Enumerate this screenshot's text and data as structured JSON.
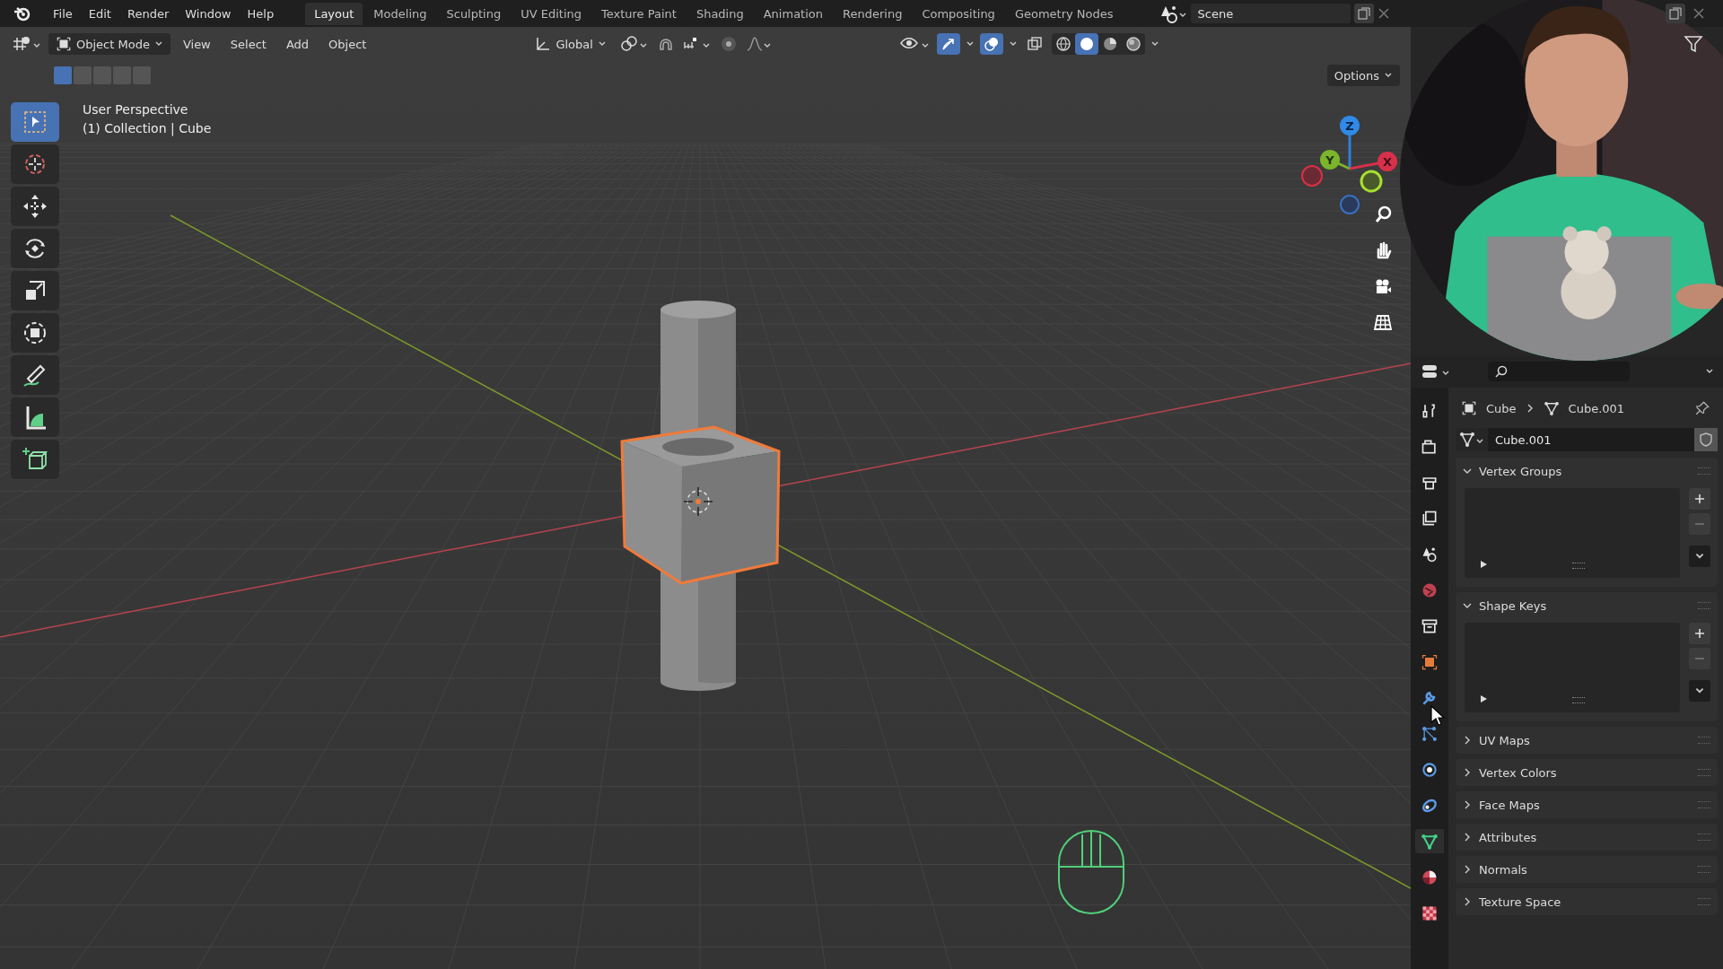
{
  "menu": [
    "File",
    "Edit",
    "Render",
    "Window",
    "Help"
  ],
  "workspaces": [
    {
      "label": "Layout",
      "selected": true
    },
    {
      "label": "Modeling",
      "selected": false
    },
    {
      "label": "Sculpting",
      "selected": false
    },
    {
      "label": "UV Editing",
      "selected": false
    },
    {
      "label": "Texture Paint",
      "selected": false
    },
    {
      "label": "Shading",
      "selected": false
    },
    {
      "label": "Animation",
      "selected": false
    },
    {
      "label": "Rendering",
      "selected": false
    },
    {
      "label": "Compositing",
      "selected": false
    },
    {
      "label": "Geometry Nodes",
      "selected": false
    }
  ],
  "scene": {
    "name": "Scene"
  },
  "viewport": {
    "mode": "Object Mode",
    "menus": [
      "View",
      "Select",
      "Add",
      "Object"
    ],
    "orientation": "Global",
    "options": "Options",
    "select_modes": [
      {
        "selected": true
      },
      {
        "selected": false
      },
      {
        "selected": false
      },
      {
        "selected": false
      },
      {
        "selected": false
      }
    ],
    "toggles": [
      {
        "kind": "gizmo",
        "on": true
      },
      {
        "kind": "overlays",
        "on": true
      },
      {
        "kind": "xray",
        "on": false
      }
    ],
    "shading": [
      {
        "kind": "wireframe",
        "selected": false
      },
      {
        "kind": "solid",
        "selected": true
      },
      {
        "kind": "material",
        "selected": false
      },
      {
        "kind": "rendered",
        "selected": false
      }
    ],
    "info": [
      "User Perspective",
      "(1) Collection | Cube"
    ],
    "tools": [
      {
        "kind": "select",
        "selected": true
      },
      {
        "kind": "cursor",
        "selected": false
      },
      {
        "kind": "move",
        "selected": false
      },
      {
        "kind": "rotate",
        "selected": false
      },
      {
        "kind": "scale",
        "selected": false
      },
      {
        "kind": "transform",
        "selected": false
      },
      {
        "kind": "annotate",
        "selected": false
      },
      {
        "kind": "measure",
        "selected": false
      },
      {
        "kind": "add-cube",
        "selected": false
      }
    ],
    "axes": [
      "Z",
      "Y",
      "X"
    ],
    "nav": [
      {
        "kind": "zoom"
      },
      {
        "kind": "hand"
      },
      {
        "kind": "camera"
      },
      {
        "kind": "grid"
      }
    ],
    "webcam": {
      "kind": "picture"
    }
  },
  "properties": {
    "tabs": [
      {
        "kind": "tool",
        "selected": false
      },
      {
        "kind": "render",
        "selected": false
      },
      {
        "kind": "output",
        "selected": false
      },
      {
        "kind": "view-layer",
        "selected": false
      },
      {
        "kind": "scene",
        "selected": false
      },
      {
        "kind": "world",
        "selected": false
      },
      {
        "kind": "collection",
        "selected": false
      },
      {
        "kind": "object",
        "selected": false
      },
      {
        "kind": "modifier",
        "selected": false
      },
      {
        "kind": "particles",
        "selected": false
      },
      {
        "kind": "physics",
        "selected": false
      },
      {
        "kind": "constraints",
        "selected": false
      },
      {
        "kind": "data",
        "selected": true
      },
      {
        "kind": "material",
        "selected": false
      },
      {
        "kind": "texture",
        "selected": false
      }
    ],
    "breadcrumb": [
      "Cube",
      "Cube.001"
    ],
    "datablock": "Cube.001",
    "panels": [
      {
        "title": "Vertex Groups",
        "expanded": true
      },
      {
        "title": "Shape Keys",
        "expanded": true
      },
      {
        "title": "UV Maps",
        "expanded": false
      },
      {
        "title": "Vertex Colors",
        "expanded": false
      },
      {
        "title": "Face Maps",
        "expanded": false
      },
      {
        "title": "Attributes",
        "expanded": false
      },
      {
        "title": "Normals",
        "expanded": false
      },
      {
        "title": "Texture Space",
        "expanded": false
      }
    ]
  }
}
